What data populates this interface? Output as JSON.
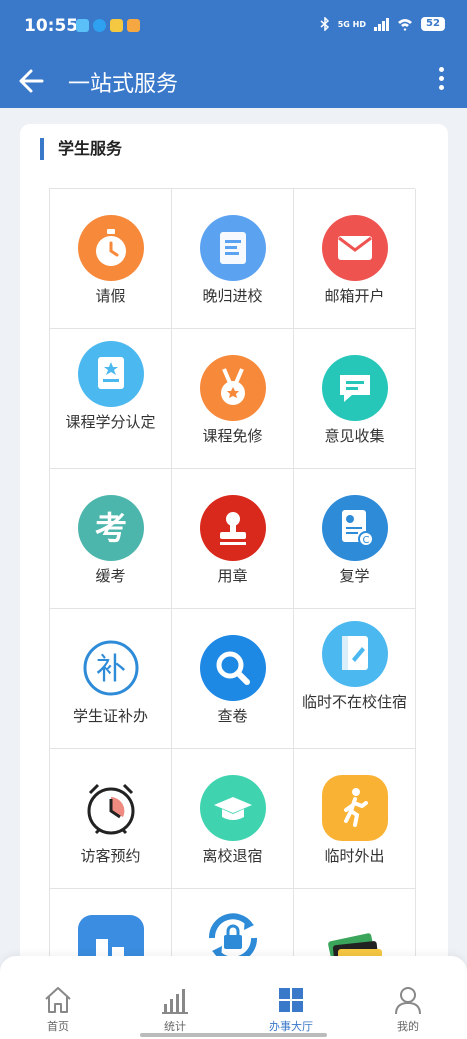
{
  "status_bar": {
    "time": "10:55",
    "network": "5G HD",
    "battery": "52"
  },
  "app_bar": {
    "title": "一站式服务"
  },
  "section": {
    "title": "学生服务"
  },
  "services": [
    {
      "label": "请假",
      "icon": "stopwatch-icon",
      "color": "#f7893b"
    },
    {
      "label": "晚归进校",
      "icon": "document-icon",
      "color": "#5ba3f0"
    },
    {
      "label": "邮箱开户",
      "icon": "mail-icon",
      "color": "#ef5350"
    },
    {
      "label": "课程学分认定",
      "icon": "certificate-icon",
      "color": "#4cb8f0"
    },
    {
      "label": "课程免修",
      "icon": "medal-icon",
      "color": "#f7893b"
    },
    {
      "label": "意见收集",
      "icon": "chat-icon",
      "color": "#26c6b9"
    },
    {
      "label": "缓考",
      "icon": "exam-icon",
      "color": "#4db6ac"
    },
    {
      "label": "用章",
      "icon": "stamp-icon",
      "color": "#d9281c"
    },
    {
      "label": "复学",
      "icon": "diploma-icon",
      "color": "#2e8bd8"
    },
    {
      "label": "学生证补办",
      "icon": "reissue-icon",
      "color": "#2e8bd8"
    },
    {
      "label": "查卷",
      "icon": "search-icon",
      "color": "#1e88e5"
    },
    {
      "label": "临时不在校住宿",
      "icon": "notebook-icon",
      "color": "#4cb8f0"
    },
    {
      "label": "访客预约",
      "icon": "alarm-clock-icon",
      "color": "#ef5350"
    },
    {
      "label": "离校退宿",
      "icon": "graduation-cap-icon",
      "color": "#3fd3b0"
    },
    {
      "label": "临时外出",
      "icon": "walking-person-icon",
      "color": "#f9b233"
    },
    {
      "label": "",
      "icon": "building-icon",
      "color": "#3a8de0"
    },
    {
      "label": "",
      "icon": "refresh-lock-icon",
      "color": "#2e8bd8"
    },
    {
      "label": "",
      "icon": "cards-icon",
      "color": "#3ba55c"
    }
  ],
  "bottom_nav": [
    {
      "label": "首页",
      "icon": "home-icon",
      "active": false
    },
    {
      "label": "统计",
      "icon": "bar-chart-icon",
      "active": false
    },
    {
      "label": "办事大厅",
      "icon": "grid-icon",
      "active": true
    },
    {
      "label": "我的",
      "icon": "user-icon",
      "active": false
    }
  ],
  "colors": {
    "primary": "#3a78c9",
    "background": "#eef1f6"
  }
}
